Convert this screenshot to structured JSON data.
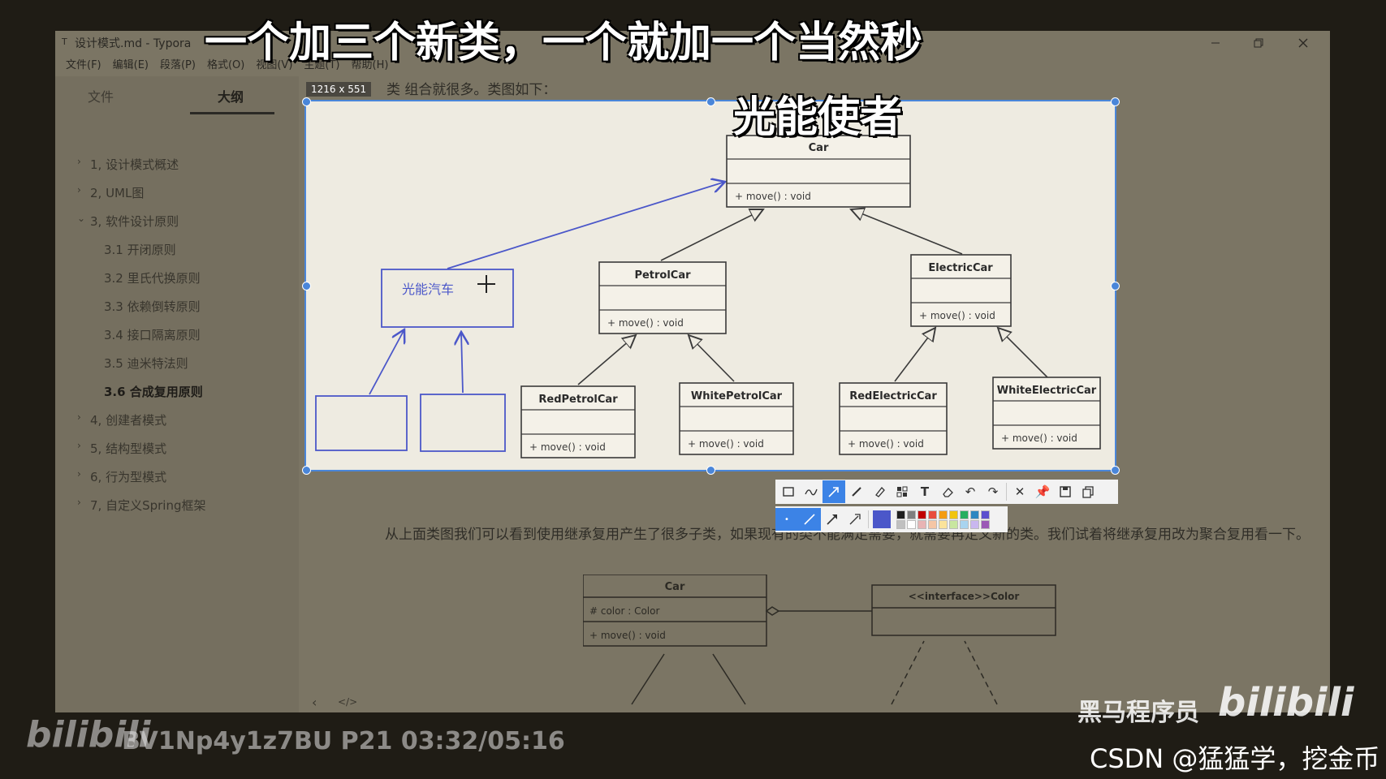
{
  "window": {
    "title": "设计模式.md - Typora",
    "menu": [
      "文件(F)",
      "编辑(E)",
      "段落(P)",
      "格式(O)",
      "视图(V)",
      "主题(T)",
      "帮助(H)"
    ]
  },
  "sidebar": {
    "tabs": [
      "文件",
      "大纲"
    ],
    "active_tab": "大纲",
    "outline": [
      {
        "label": "1, 设计模式概述",
        "level": 1,
        "collapsed": true
      },
      {
        "label": "2, UML图",
        "level": 1,
        "collapsed": true
      },
      {
        "label": "3, 软件设计原则",
        "level": 1,
        "collapsed": false
      },
      {
        "label": "3.1  开闭原则",
        "level": 2
      },
      {
        "label": "3.2  里氏代换原则",
        "level": 2
      },
      {
        "label": "3.3  依赖倒转原则",
        "level": 2
      },
      {
        "label": "3.4  接口隔离原则",
        "level": 2
      },
      {
        "label": "3.5  迪米特法则",
        "level": 2
      },
      {
        "label": "3.6  合成复用原则",
        "level": 2,
        "active": true
      },
      {
        "label": "4, 创建者模式",
        "level": 1,
        "collapsed": true
      },
      {
        "label": "5, 结构型模式",
        "level": 1,
        "collapsed": true
      },
      {
        "label": "6, 行为型模式",
        "level": 1,
        "collapsed": true
      },
      {
        "label": "7, 自定义Spring框架",
        "level": 1,
        "collapsed": true
      }
    ],
    "footer_left": "‹",
    "footer_code": "</>"
  },
  "document": {
    "head_text": "类 组合就很多。类图如下：",
    "paragraph": "从上面类图我们可以看到使用继承复用产生了很多子类，如果现有的类不能满足需要，就需要再定义新的类。我们试着将继承复用改为聚合复用看一下。"
  },
  "capture": {
    "size_label": "1216 x 551",
    "annotation_text": "光能汽车"
  },
  "uml_top": {
    "car": {
      "name": "Car",
      "method": "+ move() : void"
    },
    "petrol": {
      "name": "PetrolCar",
      "method": "+ move() : void"
    },
    "electric": {
      "name": "ElectricCar",
      "method": "+ move() : void"
    },
    "red_petrol": {
      "name": "RedPetrolCar",
      "method": "+ move() : void"
    },
    "white_petrol": {
      "name": "WhitePetrolCar",
      "method": "+ move() : void"
    },
    "red_electric": {
      "name": "RedElectricCar",
      "method": "+ move() : void"
    },
    "white_electric": {
      "name": "WhiteElectricCar",
      "method": "+ move() : void"
    }
  },
  "uml_bottom": {
    "car": {
      "name": "Car",
      "field": "# color : Color",
      "method": "+ move() : void"
    },
    "color": {
      "name": "<<interface>>Color"
    }
  },
  "toolbar": {
    "tools": [
      "rect-icon",
      "freehand-icon",
      "arrow-icon",
      "pen-icon",
      "marker-icon",
      "mosaic-icon",
      "text-icon",
      "eraser-icon",
      "undo-icon",
      "redo-icon",
      "close-icon",
      "pin-icon",
      "save-icon",
      "copy-icon"
    ],
    "palette": [
      "#1f1f1f",
      "#7f7f7f",
      "#c00000",
      "#e84c3d",
      "#f39c12",
      "#f1c40f",
      "#27ae60",
      "#2e86c1",
      "#5b4fce",
      "#c0c0c0",
      "#ffffff",
      "#e8b4b4",
      "#f5c6a5",
      "#fbe39b",
      "#c8e6a0",
      "#a9d4ef",
      "#c9b7ef",
      "#9b59b6"
    ],
    "selected_color": "#4b57c9"
  },
  "overlays": {
    "top_caption": "一个加三个新类，一个就加一个当然秒",
    "mid_caption": "光能使者",
    "bili_logo": "bilibili",
    "video_info": "BV1Np4y1z7BU P21 03:32/05:16",
    "heima": "黑马程序员",
    "csdn": "CSDN @猛猛学，挖金币"
  }
}
